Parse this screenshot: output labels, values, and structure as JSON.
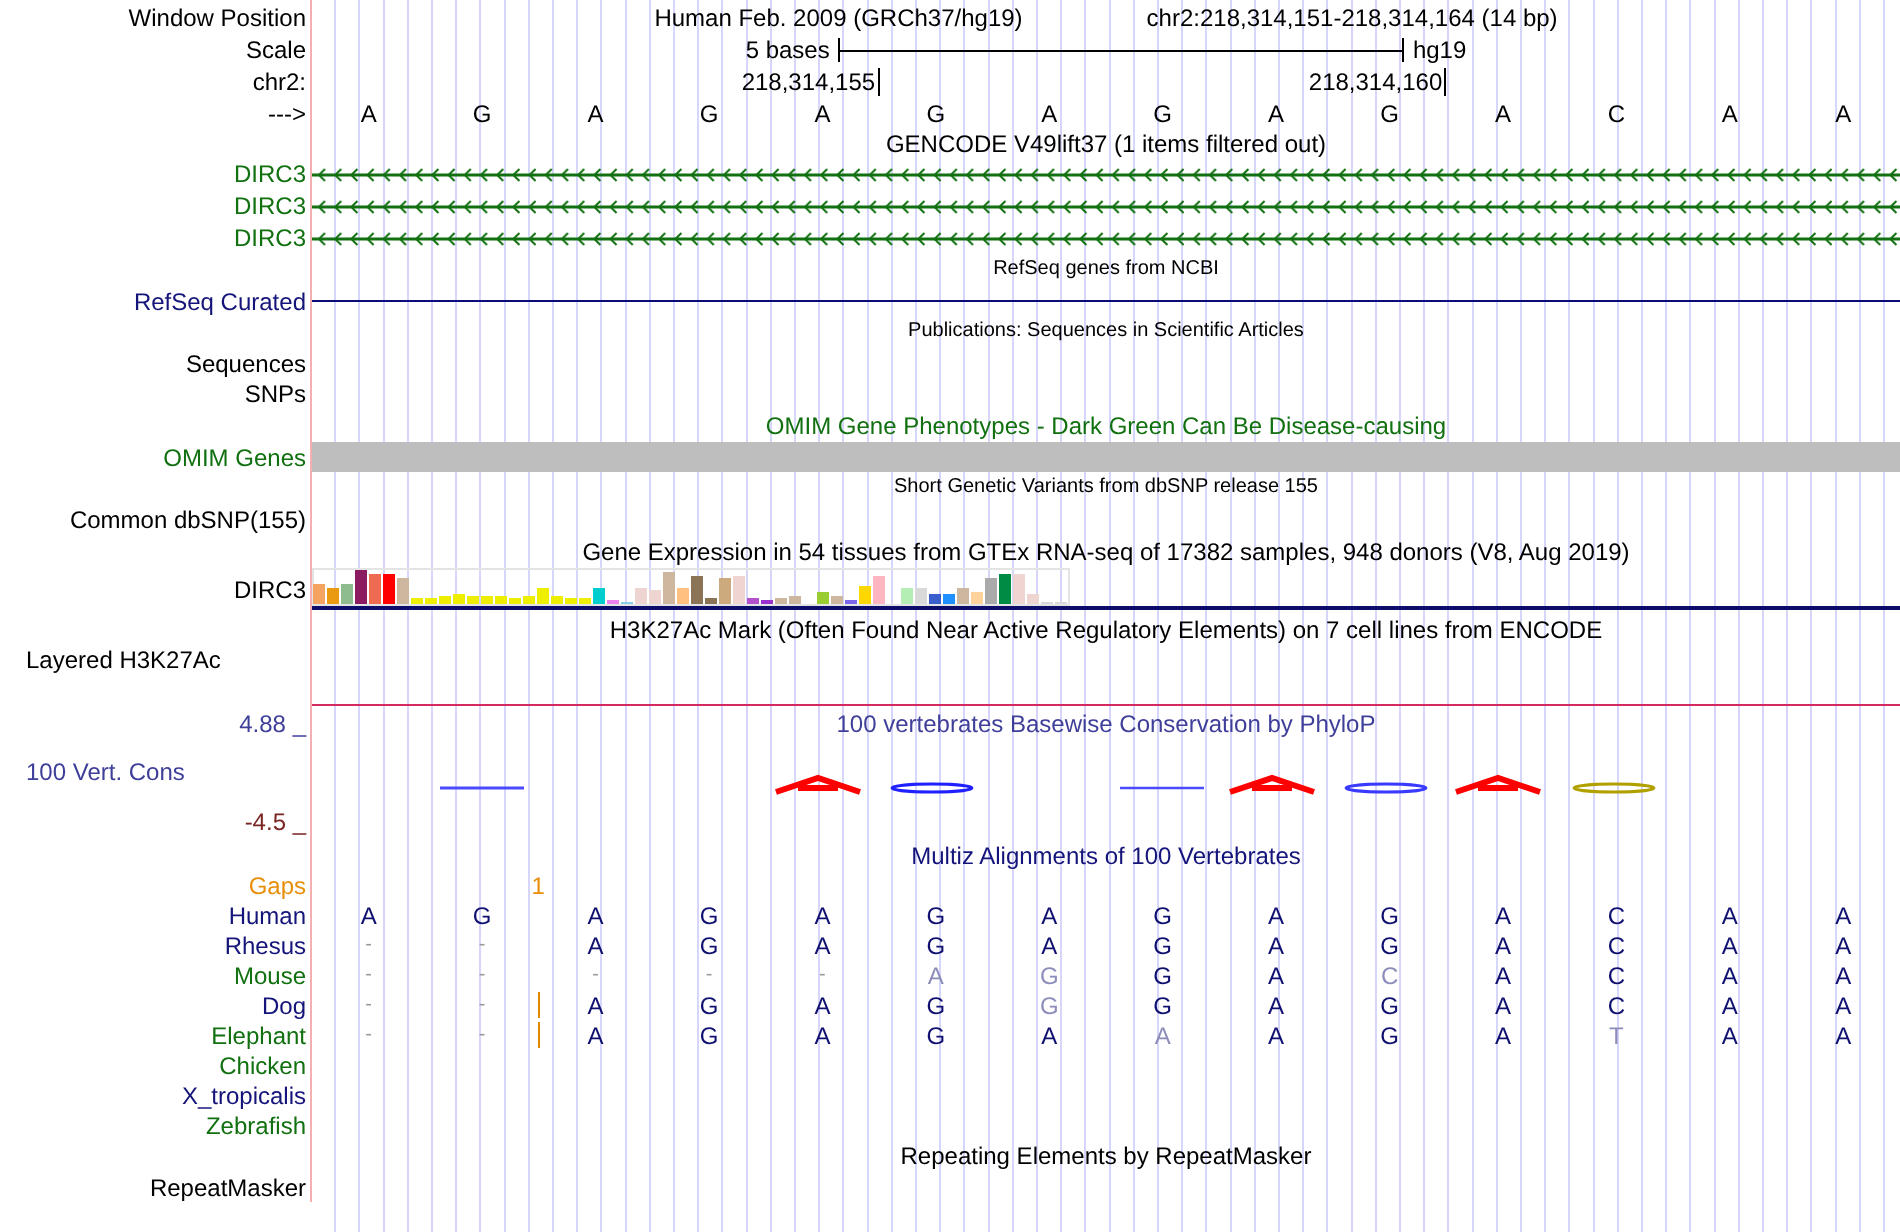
{
  "header": {
    "label": "Window Position",
    "assembly": "Human Feb. 2009 (GRCh37/hg19)",
    "position": "chr2:218,314,151-218,314,164 (14 bp)"
  },
  "scale": {
    "label": "Scale",
    "span": "5 bases",
    "assembly": "hg19"
  },
  "ruler": {
    "label": "chr2:"
  },
  "sequence": {
    "label": "--->",
    "bases": [
      {
        "letter": "A"
      },
      {
        "letter": "G",
        "gap_count": "1"
      },
      {
        "letter": "A"
      },
      {
        "letter": "G"
      },
      {
        "letter": "A",
        "tick": "218,314,155"
      },
      {
        "letter": "G"
      },
      {
        "letter": "A"
      },
      {
        "letter": "G"
      },
      {
        "letter": "A"
      },
      {
        "letter": "G",
        "tick": "218,314,160"
      },
      {
        "letter": "A"
      },
      {
        "letter": "C"
      },
      {
        "letter": "A"
      },
      {
        "letter": "A"
      }
    ]
  },
  "tracks": [
    {
      "kind": "gene",
      "title": "GENCODE V49lift37 (1 items filtered out)",
      "genes": [
        {
          "name": "DIRC3"
        },
        {
          "name": "DIRC3"
        },
        {
          "name": "DIRC3"
        }
      ]
    },
    {
      "kind": "line",
      "title": "RefSeq genes from NCBI",
      "label": "RefSeq Curated"
    },
    {
      "kind": "publications",
      "title": "Publications: Sequences in Scientific Articles",
      "labels": [
        "Sequences",
        "SNPs"
      ]
    },
    {
      "kind": "omim",
      "title": "OMIM Gene Phenotypes - Dark Green Can Be Disease-causing",
      "label": "OMIM Genes"
    },
    {
      "kind": "snp",
      "title": "Short Genetic Variants from dbSNP release 155",
      "label": "Common dbSNP(155)"
    },
    {
      "kind": "expression",
      "title": "Gene Expression in 54 tissues from GTEx RNA-seq of 17382 samples, 948 donors (V8, Aug 2019)",
      "label": "DIRC3"
    },
    {
      "kind": "signal",
      "title": "H3K27Ac Mark (Often Found Near Active Regulatory Elements) on 7 cell lines from ENCODE",
      "label": "Layered H3K27Ac"
    },
    {
      "kind": "conservation",
      "title": "100 vertebrates Basewise Conservation by PhyloP",
      "label": "100 Vert. Cons",
      "max": "4.88 _",
      "min": "-4.5 _"
    },
    {
      "kind": "multiz",
      "title": "Multiz Alignments of 100 Vertebrates",
      "gaps": {
        "label": "Gaps"
      },
      "species": [
        {
          "name": "Human",
          "color": "#14147a",
          "insertion": false,
          "letters": [
            "A",
            "G",
            "A",
            "G",
            "A",
            "G",
            "A",
            "G",
            "A",
            "G",
            "A",
            "C",
            "A",
            "A"
          ],
          "faint": [
            false,
            false,
            false,
            false,
            false,
            false,
            false,
            false,
            false,
            false,
            false,
            false,
            false,
            false
          ]
        },
        {
          "name": "Rhesus",
          "color": "#14147a",
          "insertion": false,
          "letters": [
            "-",
            "-",
            "A",
            "G",
            "A",
            "G",
            "A",
            "G",
            "A",
            "G",
            "A",
            "C",
            "A",
            "A"
          ],
          "faint": [
            false,
            false,
            false,
            false,
            false,
            false,
            false,
            false,
            false,
            false,
            false,
            false,
            false,
            false
          ]
        },
        {
          "name": "Mouse",
          "color": "#11700f",
          "insertion": false,
          "letters": [
            "-",
            "-",
            "-",
            "-",
            "-",
            "A",
            "G",
            "G",
            "A",
            "C",
            "A",
            "C",
            "A",
            "A"
          ],
          "faint": [
            false,
            false,
            false,
            false,
            false,
            true,
            true,
            false,
            false,
            true,
            false,
            false,
            false,
            false
          ]
        },
        {
          "name": "Dog",
          "color": "#14147a",
          "insertion": true,
          "letters": [
            "-",
            "-",
            "A",
            "G",
            "A",
            "G",
            "G",
            "G",
            "A",
            "G",
            "A",
            "C",
            "A",
            "A"
          ],
          "faint": [
            false,
            false,
            false,
            false,
            false,
            false,
            true,
            false,
            false,
            false,
            false,
            false,
            false,
            false
          ]
        },
        {
          "name": "Elephant",
          "color": "#11700f",
          "insertion": true,
          "letters": [
            "-",
            "-",
            "A",
            "G",
            "A",
            "G",
            "A",
            "A",
            "A",
            "G",
            "A",
            "T",
            "A",
            "A"
          ],
          "faint": [
            false,
            false,
            false,
            false,
            false,
            false,
            false,
            true,
            false,
            false,
            false,
            true,
            false,
            false
          ]
        },
        {
          "name": "Chicken",
          "color": "#11700f",
          "insertion": false
        },
        {
          "name": "X_tropicalis",
          "color": "#14147a",
          "insertion": false
        },
        {
          "name": "Zebrafish",
          "color": "#11700f",
          "insertion": false
        }
      ]
    },
    {
      "kind": "repeat",
      "title": "Repeating Elements by RepeatMasker",
      "label": "RepeatMasker"
    }
  ]
}
